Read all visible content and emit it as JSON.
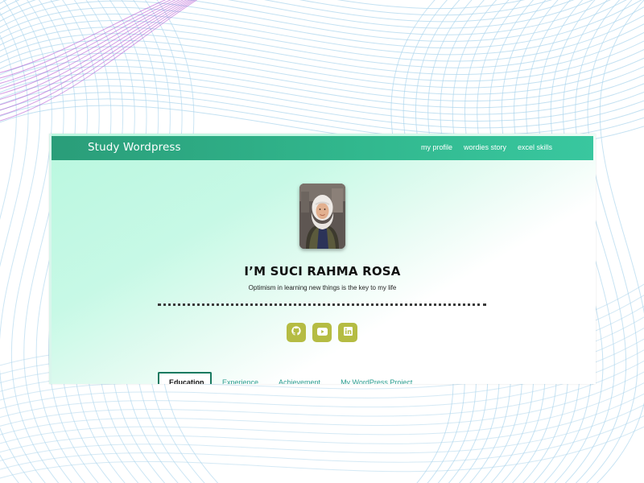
{
  "site": {
    "brand": "Study Wordpress",
    "nav": [
      {
        "label": "my profile"
      },
      {
        "label": "wordies story"
      },
      {
        "label": "excel skills"
      }
    ]
  },
  "profile": {
    "name": "I’M SUCI RAHMA ROSA",
    "tagline": "Optimism in learning new things is the key to my life",
    "socials": [
      {
        "icon": "github-icon"
      },
      {
        "icon": "youtube-icon"
      },
      {
        "icon": "linkedin-icon"
      }
    ]
  },
  "tabs": [
    {
      "label": "Education",
      "active": true
    },
    {
      "label": "Experience",
      "active": false
    },
    {
      "label": "Achievement",
      "active": false
    },
    {
      "label": "My WordPress Project",
      "active": false
    }
  ],
  "colors": {
    "nav_bar": "#31b78d",
    "social_button": "#b5bc43",
    "tab_text": "#2a9d8f",
    "hero_mint": "#b9f7df",
    "bg_lines": "#a9d4ec",
    "bg_lines_accent": "#b04fd0"
  }
}
